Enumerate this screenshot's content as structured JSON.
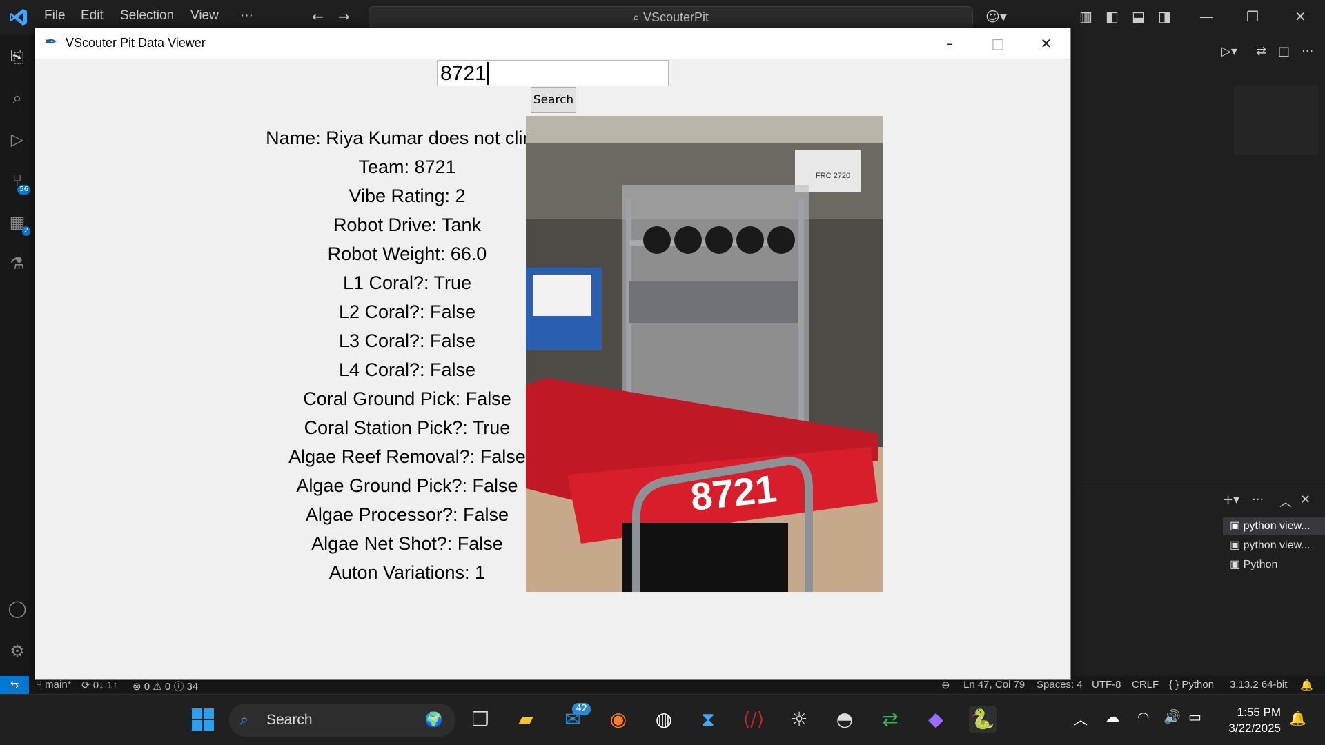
{
  "vscode": {
    "menu": [
      "File",
      "Edit",
      "Selection",
      "View",
      "···"
    ],
    "command_center": "VScouterPit",
    "activity_badges": {
      "source_control": "56",
      "extensions": "2"
    },
    "terminals": [
      "python  view...",
      "python  view...",
      "Python"
    ]
  },
  "status": {
    "branch": "main*",
    "sync": "0↓ 1↑",
    "problems": "⊗ 0 ⚠ 0 ⓘ 34",
    "position": "Ln 47, Col 79",
    "spaces": "Spaces: 4",
    "encoding": "UTF-8",
    "eol": "CRLF",
    "language": "{ } Python",
    "interpreter": "3.13.2 64-bit"
  },
  "window": {
    "title": "VScouter Pit Data Viewer",
    "search_value": "8721",
    "search_button": "Search",
    "fields": [
      "Name: Riya Kumar does not climb",
      "Team: 8721",
      "Vibe Rating: 2",
      "Robot Drive: Tank",
      "Robot Weight: 66.0",
      "L1 Coral?: True",
      "L2 Coral?: False",
      "L3 Coral?: False",
      "L4 Coral?: False",
      "Coral Ground Pick: False",
      "Coral Station Pick?: True",
      "Algae Reef Removal?: False",
      "Algae Ground Pick?: False",
      "Algae Processor?: False",
      "Algae Net Shot?: False",
      "Auton Variations: 1"
    ],
    "photo": {
      "bumper_text": "8721",
      "banner_text": "FRC 2720"
    }
  },
  "taskbar": {
    "search_label": "Search",
    "mail_badge": "42",
    "time": "1:55 PM",
    "date": "3/22/2025"
  }
}
